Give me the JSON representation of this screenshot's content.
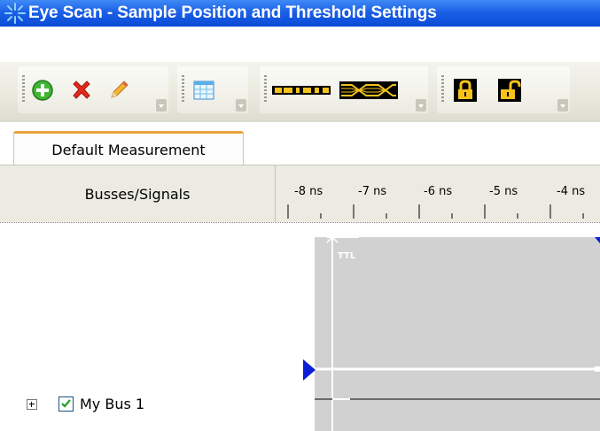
{
  "window": {
    "title": "Eye Scan - Sample Position and Threshold Settings",
    "icon": "sparkle-icon"
  },
  "toolbar": {
    "groups": [
      {
        "buttons": [
          {
            "name": "add-icon"
          },
          {
            "name": "delete-icon"
          },
          {
            "name": "edit-pencil-icon"
          }
        ]
      },
      {
        "buttons": [
          {
            "name": "table-icon"
          }
        ]
      },
      {
        "buttons": [
          {
            "name": "bus-waveform-icon"
          },
          {
            "name": "eye-diagram-icon"
          }
        ]
      },
      {
        "buttons": [
          {
            "name": "lock-icon"
          },
          {
            "name": "unlock-icon"
          }
        ]
      }
    ]
  },
  "tabs": [
    {
      "label": "Default Measurement"
    }
  ],
  "header": {
    "left_label": "Busses/Signals",
    "time_ticks": [
      "-8 ns",
      "-7 ns",
      "-6 ns",
      "-5 ns",
      "-4 ns"
    ]
  },
  "waveform": {
    "threshold_label": "TTL"
  },
  "signals": [
    {
      "label": "My Bus 1",
      "checked": true
    }
  ],
  "colors": {
    "title_bar": "#1c60e6",
    "tab_accent": "#e8a33a",
    "marker": "#0a1fd6"
  }
}
